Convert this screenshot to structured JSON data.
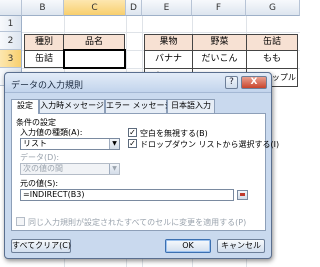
{
  "sheet": {
    "columns": [
      "B",
      "C",
      "D",
      "E",
      "F",
      "G"
    ],
    "rows": [
      "1",
      "2",
      "3",
      "4"
    ],
    "left_table": {
      "header": [
        "種別",
        "品名"
      ],
      "row3": [
        "缶詰",
        ""
      ]
    },
    "right_table": {
      "header": [
        "果物",
        "野菜",
        "缶詰"
      ],
      "row3": [
        "バナナ",
        "だいこん",
        "もも"
      ],
      "row4": [
        "ねぶこ",
        "",
        "パイナップル"
      ]
    }
  },
  "dialog": {
    "title": "データの入力規則",
    "help": "?",
    "close": "X",
    "tabs": [
      "設定",
      "入力時メッセージ",
      "エラー メッセージ",
      "日本語入力"
    ],
    "section": "条件の設定",
    "allow_label": "入力値の種類(A):",
    "allow_value": "リスト",
    "ignore_blank": "空白を無視する(B)",
    "dropdown": "ドロップダウン リストから選択する(I)",
    "data_label": "データ(D):",
    "data_value": "次の値の間",
    "source_label": "元の値(S):",
    "source_value": "=INDIRECT(B3)",
    "apply_all": "同じ入力規則が設定されたすべてのセルに変更を適用する(P)",
    "clear_button": "すべてクリア(C)",
    "ok_button": "OK",
    "cancel_button": "キャンセル"
  }
}
